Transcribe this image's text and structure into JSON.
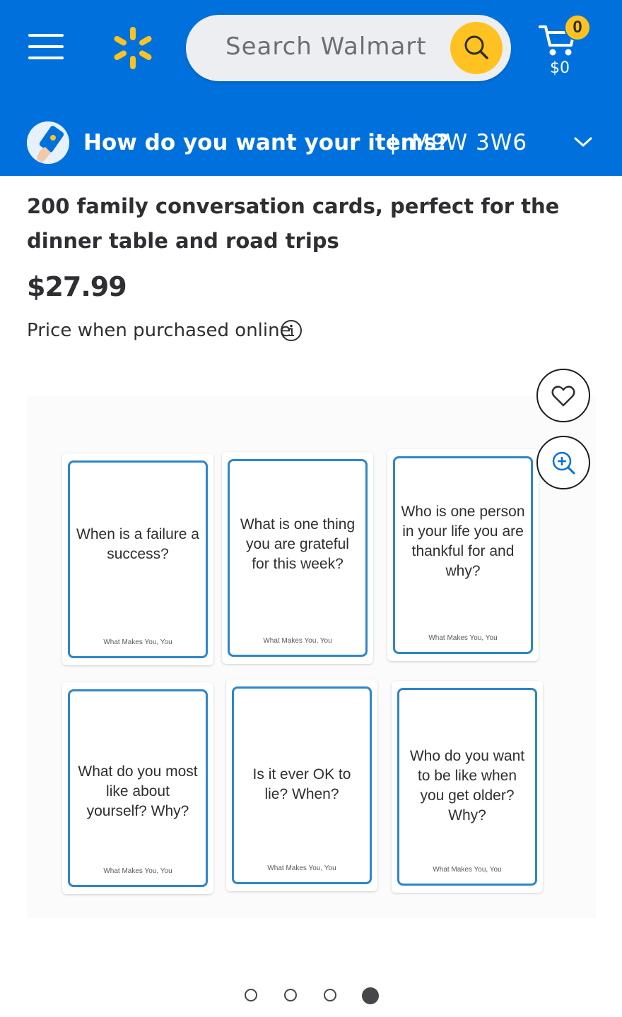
{
  "header": {
    "search_placeholder": "Search Walmart",
    "cart_count": "0",
    "cart_total": "$0"
  },
  "delivery": {
    "prompt": "How do you want your items?",
    "separator": "|",
    "postal_code": "M9W 3W6"
  },
  "product": {
    "title": "200 family conversation cards, perfect for the dinner table and road trips",
    "price": "$27.99",
    "price_note": "Price when purchased online"
  },
  "cards": [
    {
      "question": "When is a failure a success?",
      "brand": "What Makes You, You"
    },
    {
      "question": "What is one thing you are grateful for this week?",
      "brand": "What Makes You, You"
    },
    {
      "question": "Who is one person in your life you are thankful for and why?",
      "brand": "What Makes You, You"
    },
    {
      "question": "What do you most like about yourself? Why?",
      "brand": "What Makes You, You"
    },
    {
      "question": "Is it ever OK to lie? When?",
      "brand": "What Makes You, You"
    },
    {
      "question": "Who do you want to be like when you get older? Why?",
      "brand": "What Makes You, You"
    }
  ],
  "carousel": {
    "slide_count": 4,
    "active_index": 3
  },
  "colors": {
    "brand_blue": "#0071dc",
    "spark_yellow": "#ffc220",
    "card_border": "#2e86c8"
  },
  "icons": [
    "menu-icon",
    "spark-logo-icon",
    "search-icon",
    "cart-icon",
    "delivery-phone-icon",
    "chevron-down-icon",
    "info-icon",
    "heart-icon",
    "zoom-in-icon"
  ]
}
